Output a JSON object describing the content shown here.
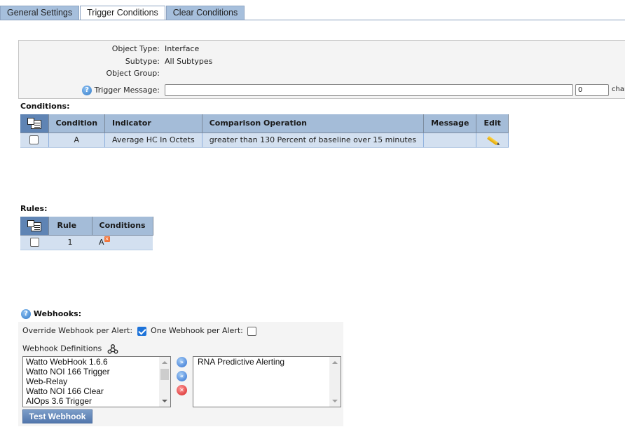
{
  "tabs": [
    {
      "label": "General Settings",
      "active": false
    },
    {
      "label": "Trigger Conditions",
      "active": true
    },
    {
      "label": "Clear Conditions",
      "active": false
    }
  ],
  "info": {
    "object_type_label": "Object Type:",
    "object_type_value": "Interface",
    "subtype_label": "Subtype:",
    "subtype_value": "All Subtypes",
    "object_group_label": "Object Group:",
    "object_group_value": "",
    "trigger_message_label": "Trigger Message:",
    "trigger_message_value": "",
    "char_count": "0",
    "chars_label": "chara"
  },
  "conditions": {
    "title": "Conditions:",
    "headers": [
      "Condition",
      "Indicator",
      "Comparison Operation",
      "Message",
      "Edit"
    ],
    "rows": [
      {
        "condition": "A",
        "indicator": "Average HC In Octets",
        "comparison": "greater than 130 Percent of baseline over 15 minutes",
        "message": "",
        "checked": false
      }
    ]
  },
  "rules": {
    "title": "Rules:",
    "headers": [
      "Rule",
      "Conditions"
    ],
    "rows": [
      {
        "rule": "1",
        "conditions": "A",
        "remove_glyph": "✕",
        "checked": false
      }
    ]
  },
  "webhooks": {
    "title": "Webhooks:",
    "override_label": "Override Webhook per Alert:",
    "override_checked": true,
    "one_per_alert_label": "One Webhook per Alert:",
    "one_per_alert_checked": false,
    "definitions_label": "Webhook Definitions",
    "available": [
      "Watto WebHook 1.6.6",
      "Watto NOI 166 Trigger",
      "Web-Relay",
      "Watto NOI 166 Clear",
      "AIOps 3.6 Trigger"
    ],
    "selected": [
      "RNA Predictive Alerting"
    ],
    "add_glyph": "»",
    "remove_glyph": "«",
    "clear_glyph": "✕",
    "test_button_label": "Test Webhook"
  },
  "help_glyph": "?"
}
